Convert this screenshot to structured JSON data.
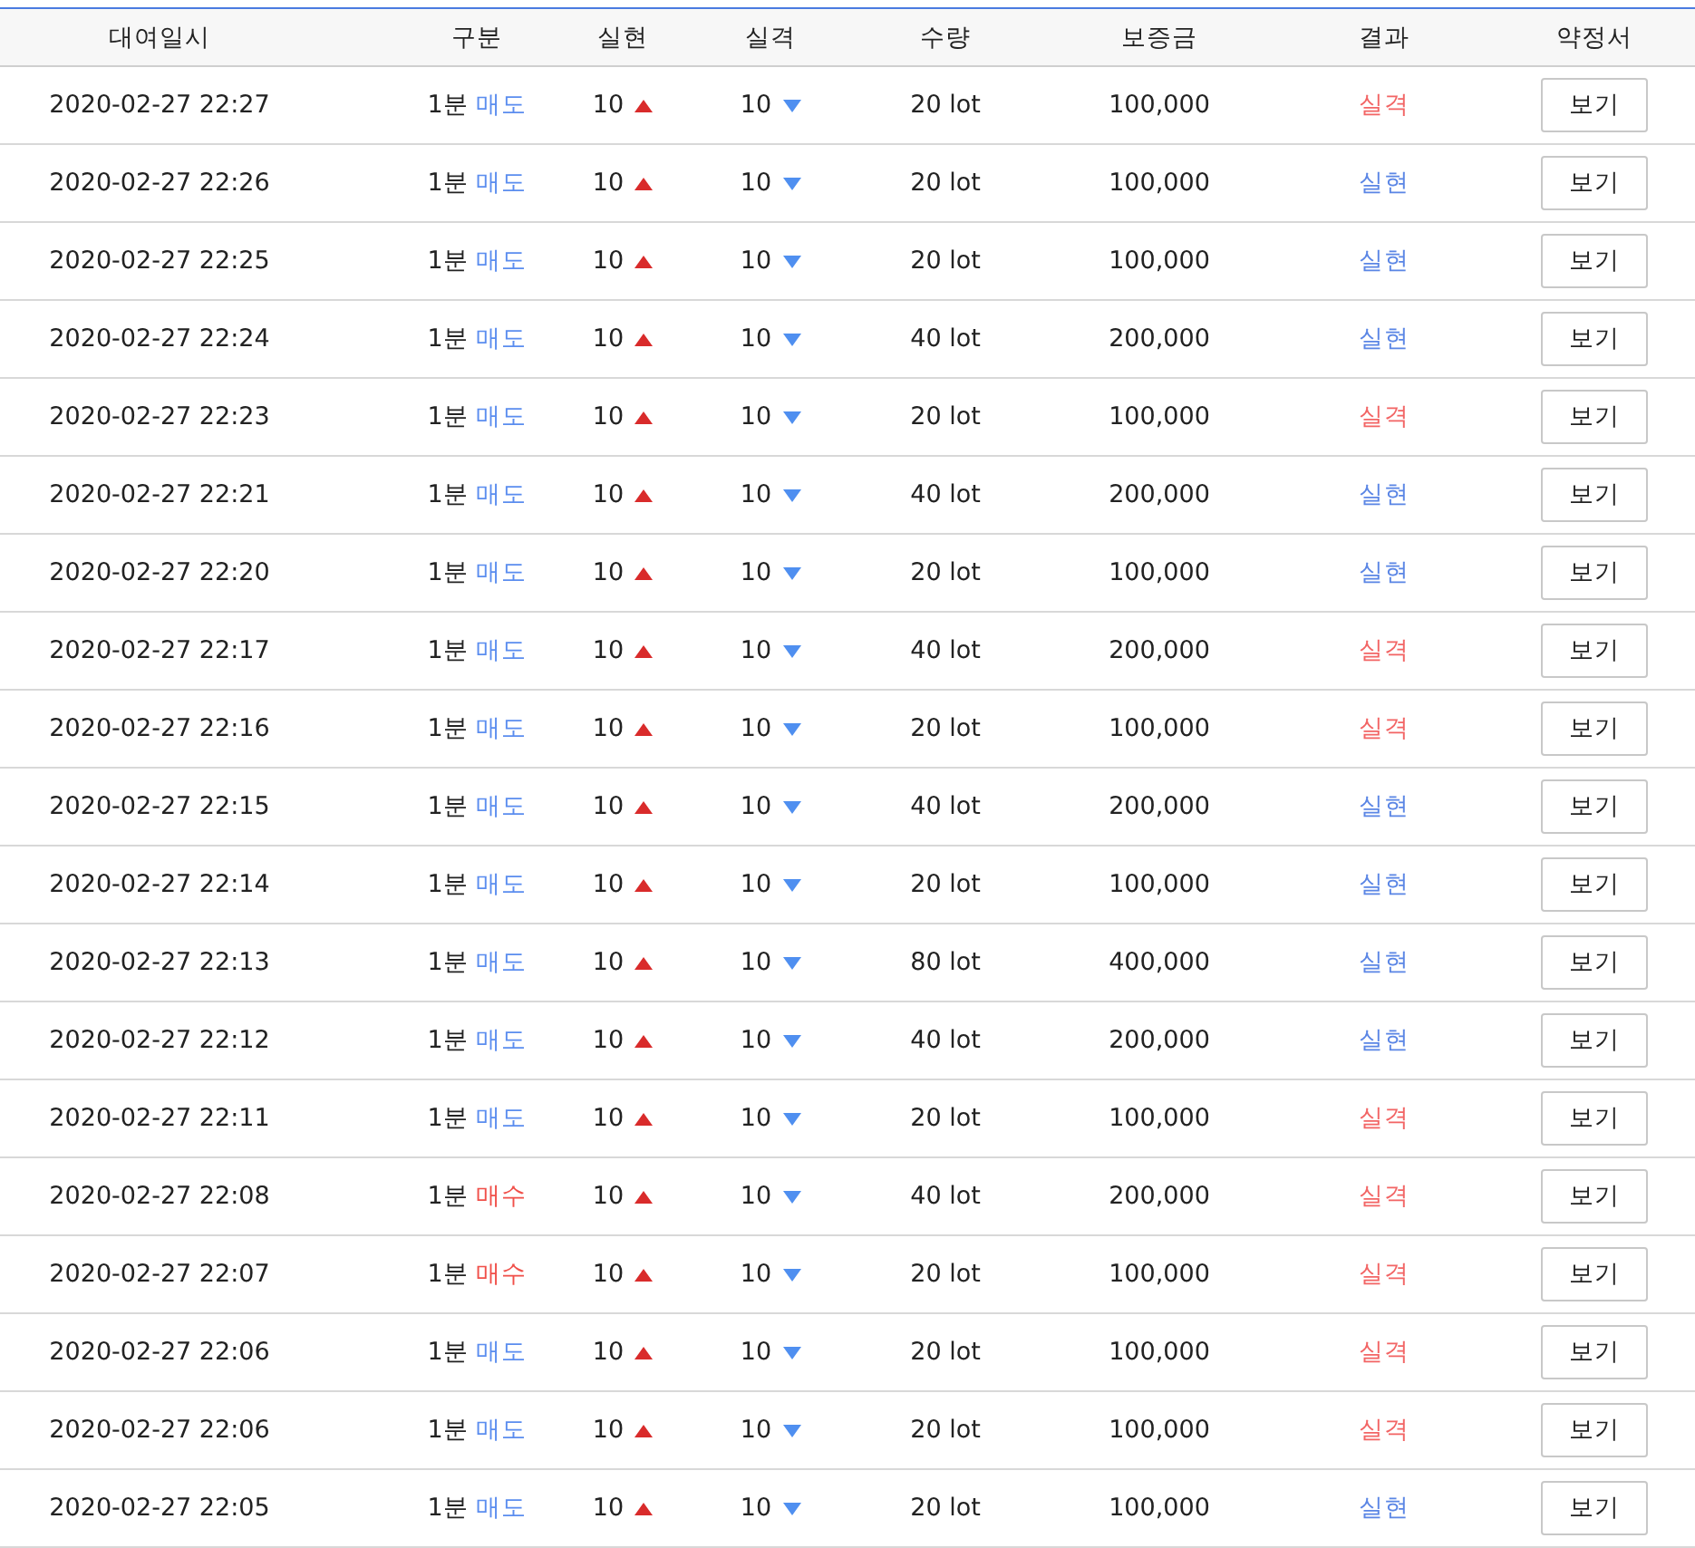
{
  "table": {
    "columns": [
      "대여일시",
      "구분",
      "실현",
      "실격",
      "수량",
      "보증금",
      "결과",
      "약정서"
    ],
    "rows": [
      {
        "datetime": "2020-02-27 22:27",
        "interval": "1분",
        "side": {
          "text": "매도",
          "kind": "sell"
        },
        "realized": "10",
        "failed": "10",
        "quantity": "20 lot",
        "deposit": "100,000",
        "result": {
          "text": "실격",
          "kind": "fail"
        },
        "button": "보기"
      },
      {
        "datetime": "2020-02-27 22:26",
        "interval": "1분",
        "side": {
          "text": "매도",
          "kind": "sell"
        },
        "realized": "10",
        "failed": "10",
        "quantity": "20 lot",
        "deposit": "100,000",
        "result": {
          "text": "실현",
          "kind": "win"
        },
        "button": "보기"
      },
      {
        "datetime": "2020-02-27 22:25",
        "interval": "1분",
        "side": {
          "text": "매도",
          "kind": "sell"
        },
        "realized": "10",
        "failed": "10",
        "quantity": "20 lot",
        "deposit": "100,000",
        "result": {
          "text": "실현",
          "kind": "win"
        },
        "button": "보기"
      },
      {
        "datetime": "2020-02-27 22:24",
        "interval": "1분",
        "side": {
          "text": "매도",
          "kind": "sell"
        },
        "realized": "10",
        "failed": "10",
        "quantity": "40 lot",
        "deposit": "200,000",
        "result": {
          "text": "실현",
          "kind": "win"
        },
        "button": "보기"
      },
      {
        "datetime": "2020-02-27 22:23",
        "interval": "1분",
        "side": {
          "text": "매도",
          "kind": "sell"
        },
        "realized": "10",
        "failed": "10",
        "quantity": "20 lot",
        "deposit": "100,000",
        "result": {
          "text": "실격",
          "kind": "fail"
        },
        "button": "보기"
      },
      {
        "datetime": "2020-02-27 22:21",
        "interval": "1분",
        "side": {
          "text": "매도",
          "kind": "sell"
        },
        "realized": "10",
        "failed": "10",
        "quantity": "40 lot",
        "deposit": "200,000",
        "result": {
          "text": "실현",
          "kind": "win"
        },
        "button": "보기"
      },
      {
        "datetime": "2020-02-27 22:20",
        "interval": "1분",
        "side": {
          "text": "매도",
          "kind": "sell"
        },
        "realized": "10",
        "failed": "10",
        "quantity": "20 lot",
        "deposit": "100,000",
        "result": {
          "text": "실현",
          "kind": "win"
        },
        "button": "보기"
      },
      {
        "datetime": "2020-02-27 22:17",
        "interval": "1분",
        "side": {
          "text": "매도",
          "kind": "sell"
        },
        "realized": "10",
        "failed": "10",
        "quantity": "40 lot",
        "deposit": "200,000",
        "result": {
          "text": "실격",
          "kind": "fail"
        },
        "button": "보기"
      },
      {
        "datetime": "2020-02-27 22:16",
        "interval": "1분",
        "side": {
          "text": "매도",
          "kind": "sell"
        },
        "realized": "10",
        "failed": "10",
        "quantity": "20 lot",
        "deposit": "100,000",
        "result": {
          "text": "실격",
          "kind": "fail"
        },
        "button": "보기"
      },
      {
        "datetime": "2020-02-27 22:15",
        "interval": "1분",
        "side": {
          "text": "매도",
          "kind": "sell"
        },
        "realized": "10",
        "failed": "10",
        "quantity": "40 lot",
        "deposit": "200,000",
        "result": {
          "text": "실현",
          "kind": "win"
        },
        "button": "보기"
      },
      {
        "datetime": "2020-02-27 22:14",
        "interval": "1분",
        "side": {
          "text": "매도",
          "kind": "sell"
        },
        "realized": "10",
        "failed": "10",
        "quantity": "20 lot",
        "deposit": "100,000",
        "result": {
          "text": "실현",
          "kind": "win"
        },
        "button": "보기"
      },
      {
        "datetime": "2020-02-27 22:13",
        "interval": "1분",
        "side": {
          "text": "매도",
          "kind": "sell"
        },
        "realized": "10",
        "failed": "10",
        "quantity": "80 lot",
        "deposit": "400,000",
        "result": {
          "text": "실현",
          "kind": "win"
        },
        "button": "보기"
      },
      {
        "datetime": "2020-02-27 22:12",
        "interval": "1분",
        "side": {
          "text": "매도",
          "kind": "sell"
        },
        "realized": "10",
        "failed": "10",
        "quantity": "40 lot",
        "deposit": "200,000",
        "result": {
          "text": "실현",
          "kind": "win"
        },
        "button": "보기"
      },
      {
        "datetime": "2020-02-27 22:11",
        "interval": "1분",
        "side": {
          "text": "매도",
          "kind": "sell"
        },
        "realized": "10",
        "failed": "10",
        "quantity": "20 lot",
        "deposit": "100,000",
        "result": {
          "text": "실격",
          "kind": "fail"
        },
        "button": "보기"
      },
      {
        "datetime": "2020-02-27 22:08",
        "interval": "1분",
        "side": {
          "text": "매수",
          "kind": "buy"
        },
        "realized": "10",
        "failed": "10",
        "quantity": "40 lot",
        "deposit": "200,000",
        "result": {
          "text": "실격",
          "kind": "fail"
        },
        "button": "보기"
      },
      {
        "datetime": "2020-02-27 22:07",
        "interval": "1분",
        "side": {
          "text": "매수",
          "kind": "buy"
        },
        "realized": "10",
        "failed": "10",
        "quantity": "20 lot",
        "deposit": "100,000",
        "result": {
          "text": "실격",
          "kind": "fail"
        },
        "button": "보기"
      },
      {
        "datetime": "2020-02-27 22:06",
        "interval": "1분",
        "side": {
          "text": "매도",
          "kind": "sell"
        },
        "realized": "10",
        "failed": "10",
        "quantity": "20 lot",
        "deposit": "100,000",
        "result": {
          "text": "실격",
          "kind": "fail"
        },
        "button": "보기"
      },
      {
        "datetime": "2020-02-27 22:06",
        "interval": "1분",
        "side": {
          "text": "매도",
          "kind": "sell"
        },
        "realized": "10",
        "failed": "10",
        "quantity": "20 lot",
        "deposit": "100,000",
        "result": {
          "text": "실격",
          "kind": "fail"
        },
        "button": "보기"
      },
      {
        "datetime": "2020-02-27 22:05",
        "interval": "1분",
        "side": {
          "text": "매도",
          "kind": "sell"
        },
        "realized": "10",
        "failed": "10",
        "quantity": "20 lot",
        "deposit": "100,000",
        "result": {
          "text": "실현",
          "kind": "win"
        },
        "button": "보기"
      }
    ]
  }
}
